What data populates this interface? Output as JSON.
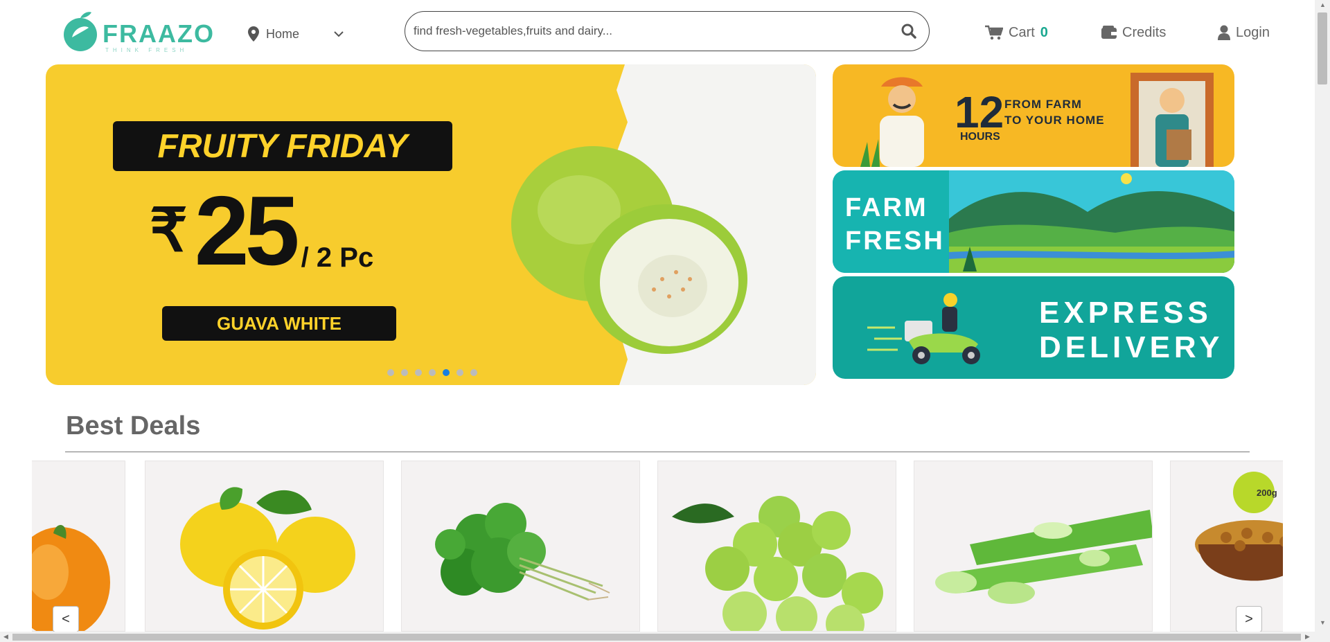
{
  "header": {
    "logo_text": "FRAAZO",
    "logo_tagline": "THINK FRESH",
    "location_label": "Home",
    "search_placeholder": "find fresh-vegetables,fruits and dairy...",
    "cart_label": "Cart",
    "cart_count": "0",
    "credits_label": "Credits",
    "login_label": "Login"
  },
  "hero": {
    "title": "FRUITY FRIDAY",
    "currency": "₹",
    "price": "25",
    "unit": "/ 2 Pc",
    "product": "GUAVA WHITE",
    "slide_count": 7,
    "active_slide": 5
  },
  "side_banners": [
    {
      "big": "12",
      "line1": "FROM FARM",
      "line2": "TO YOUR HOME",
      "small": "HOURS"
    },
    {
      "line1": "FARM",
      "line2": "FRESH"
    },
    {
      "line1": "EXPRESS",
      "line2": "DELIVERY"
    }
  ],
  "deals": {
    "title": "Best Deals",
    "prev_label": "<",
    "next_label": ">",
    "items": [
      {
        "icon": "orange-bell-pepper-image"
      },
      {
        "icon": "lemon-image"
      },
      {
        "icon": "coriander-image"
      },
      {
        "icon": "amla-gooseberry-image"
      },
      {
        "icon": "aloe-vera-image"
      },
      {
        "icon": "dry-fruit-bowl-image",
        "tag": "200g"
      }
    ]
  },
  "colors": {
    "brand": "#3dbaa0",
    "hero_yellow": "#f7cc2d",
    "teal": "#17b4b0",
    "active_dot": "#1a7fe0"
  }
}
